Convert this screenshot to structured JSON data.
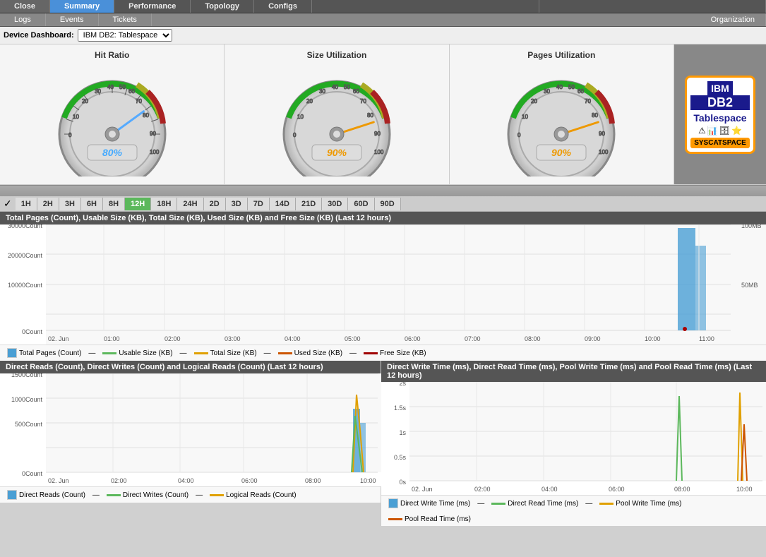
{
  "tabs_top": [
    {
      "label": "Close",
      "active": false
    },
    {
      "label": "Summary",
      "active": true
    },
    {
      "label": "Performance",
      "active": false
    },
    {
      "label": "Topology",
      "active": false
    },
    {
      "label": "Configs",
      "active": false
    },
    {
      "label": "",
      "active": false
    },
    {
      "label": "",
      "active": false
    }
  ],
  "tabs_second": [
    {
      "label": "Logs"
    },
    {
      "label": "Events"
    },
    {
      "label": "Tickets"
    },
    {
      "label": ""
    },
    {
      "label": ""
    },
    {
      "label": ""
    },
    {
      "label": ""
    },
    {
      "label": ""
    }
  ],
  "org_label": "Organization",
  "device_dashboard_label": "Device Dashboard:",
  "device_select": "IBM DB2: Tablespace",
  "gauges": [
    {
      "title": "Hit Ratio",
      "value": "80%",
      "needle_angle": -60,
      "color": "#4ab"
    },
    {
      "title": "Size Utilization",
      "value": "90%",
      "needle_angle": 30,
      "color": "#e90"
    },
    {
      "title": "Pages Utilization",
      "value": "90%",
      "needle_angle": 30,
      "color": "#e90"
    }
  ],
  "logo": {
    "ibm": "IBM",
    "db2": "DB2",
    "type": "Tablespace",
    "name": "SYSCATSPACE"
  },
  "time_buttons": [
    "1H",
    "2H",
    "3H",
    "6H",
    "8H",
    "12H",
    "18H",
    "24H",
    "2D",
    "3D",
    "7D",
    "14D",
    "21D",
    "30D",
    "60D",
    "90D"
  ],
  "active_time": "12H",
  "chart1": {
    "title": "Total Pages (Count), Usable Size (KB), Total Size (KB), Used Size (KB) and Free Size (KB) (Last 12 hours)",
    "y_labels": [
      "30000Count",
      "20000Count",
      "10000Count",
      "0Count"
    ],
    "y_right_labels": [
      "100MB",
      "50MB",
      ""
    ],
    "x_labels": [
      "02. Jun",
      "01:00",
      "02:00",
      "03:00",
      "04:00",
      "05:00",
      "06:00",
      "07:00",
      "08:00",
      "09:00",
      "10:00",
      "11:00"
    ],
    "legend": [
      {
        "label": "Total Pages (Count)",
        "color": "#4a9fd4",
        "type": "box"
      },
      {
        "label": "Usable Size (KB)",
        "color": "#5cb85c",
        "type": "line"
      },
      {
        "label": "Total Size (KB)",
        "color": "#e0a000",
        "type": "line"
      },
      {
        "label": "Used Size (KB)",
        "color": "#cc5500",
        "type": "line"
      },
      {
        "label": "Free Size (KB)",
        "color": "#a00000",
        "type": "line"
      }
    ]
  },
  "chart2": {
    "title": "Direct Reads (Count), Direct Writes (Count) and Logical Reads (Count) (Last 12 hours)",
    "y_labels": [
      "1500Count",
      "1000Count",
      "500Count",
      "0Count"
    ],
    "x_labels": [
      "02. Jun",
      "02:00",
      "04:00",
      "06:00",
      "08:00",
      "10:00"
    ],
    "legend": [
      {
        "label": "Direct Reads (Count)",
        "color": "#4a9fd4",
        "type": "box"
      },
      {
        "label": "Direct Writes (Count)",
        "color": "#5cb85c",
        "type": "line"
      },
      {
        "label": "Logical Reads (Count)",
        "color": "#e0a000",
        "type": "line"
      }
    ]
  },
  "chart3": {
    "title": "Direct Write Time (ms), Direct Read Time (ms), Pool Write Time (ms) and Pool Read Time (ms) (Last 12 hours)",
    "y_labels": [
      "2s",
      "1.5s",
      "1s",
      "0.5s",
      "0s"
    ],
    "x_labels": [
      "02. Jun",
      "02:00",
      "04:00",
      "06:00",
      "08:00",
      "10:00"
    ],
    "legend": [
      {
        "label": "Direct Write Time (ms)",
        "color": "#4a9fd4",
        "type": "box"
      },
      {
        "label": "Direct Read Time (ms)",
        "color": "#5cb85c",
        "type": "line"
      },
      {
        "label": "Pool Write Time (ms)",
        "color": "#e0a000",
        "type": "line"
      },
      {
        "label": "Pool Read Time (ms)",
        "color": "#cc5500",
        "type": "line"
      }
    ]
  }
}
